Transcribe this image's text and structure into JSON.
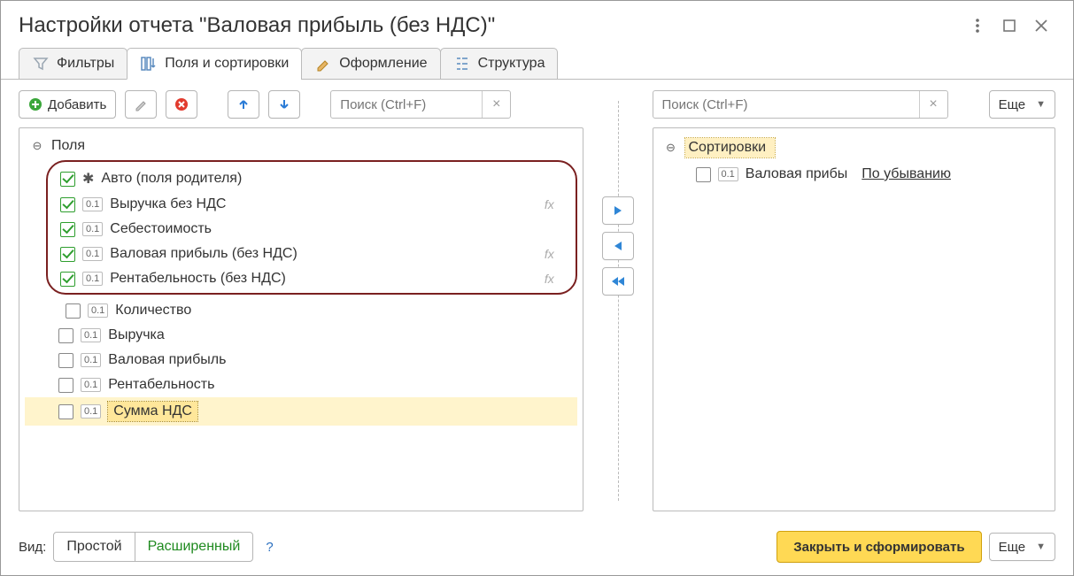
{
  "title": "Настройки отчета \"Валовая прибыль (без НДС)\"",
  "window_buttons": {
    "more": "⋮",
    "maximize": "",
    "close": ""
  },
  "tabs": [
    {
      "label": "Фильтры",
      "active": false
    },
    {
      "label": "Поля и сортировки",
      "active": true
    },
    {
      "label": "Оформление",
      "active": false
    },
    {
      "label": "Структура",
      "active": false
    }
  ],
  "left_toolbar": {
    "add_label": "Добавить",
    "search_placeholder": "Поиск (Ctrl+F)"
  },
  "right_toolbar": {
    "search_placeholder": "Поиск (Ctrl+F)",
    "more_label": "Еще"
  },
  "fields_header": "Поля",
  "sort_header": "Сортировки",
  "badge_01": "0.1",
  "fx_label": "fx",
  "fields": [
    {
      "checked": true,
      "icon": "star",
      "label": "Авто (поля родителя)",
      "fx": false,
      "highlighted": true
    },
    {
      "checked": true,
      "icon": "01",
      "label": "Выручка без НДС",
      "fx": true,
      "highlighted": true
    },
    {
      "checked": true,
      "icon": "01",
      "label": "Себестоимость",
      "fx": false,
      "highlighted": true
    },
    {
      "checked": true,
      "icon": "01",
      "label": "Валовая прибыль (без НДС)",
      "fx": true,
      "highlighted": true
    },
    {
      "checked": true,
      "icon": "01",
      "label": "Рентабельность (без НДС)",
      "fx": true,
      "highlighted": true
    },
    {
      "checked": false,
      "icon": "01",
      "label": "Количество",
      "fx": false,
      "highlighted": false
    },
    {
      "checked": false,
      "icon": "01",
      "label": "Выручка",
      "fx": false,
      "highlighted": false
    },
    {
      "checked": false,
      "icon": "01",
      "label": "Валовая прибыль",
      "fx": false,
      "highlighted": false
    },
    {
      "checked": false,
      "icon": "01",
      "label": "Рентабельность",
      "fx": false,
      "highlighted": false
    },
    {
      "checked": false,
      "icon": "01",
      "label": "Сумма НДС",
      "fx": false,
      "highlighted": false,
      "selected": true
    }
  ],
  "sort_items": [
    {
      "checked": false,
      "label": "Валовая прибы",
      "direction": "По убыванию"
    }
  ],
  "view_label": "Вид:",
  "view_modes": {
    "simple": "Простой",
    "advanced": "Расширенный"
  },
  "help_symbol": "?",
  "primary_button": "Закрыть и сформировать",
  "footer_more": "Еще"
}
